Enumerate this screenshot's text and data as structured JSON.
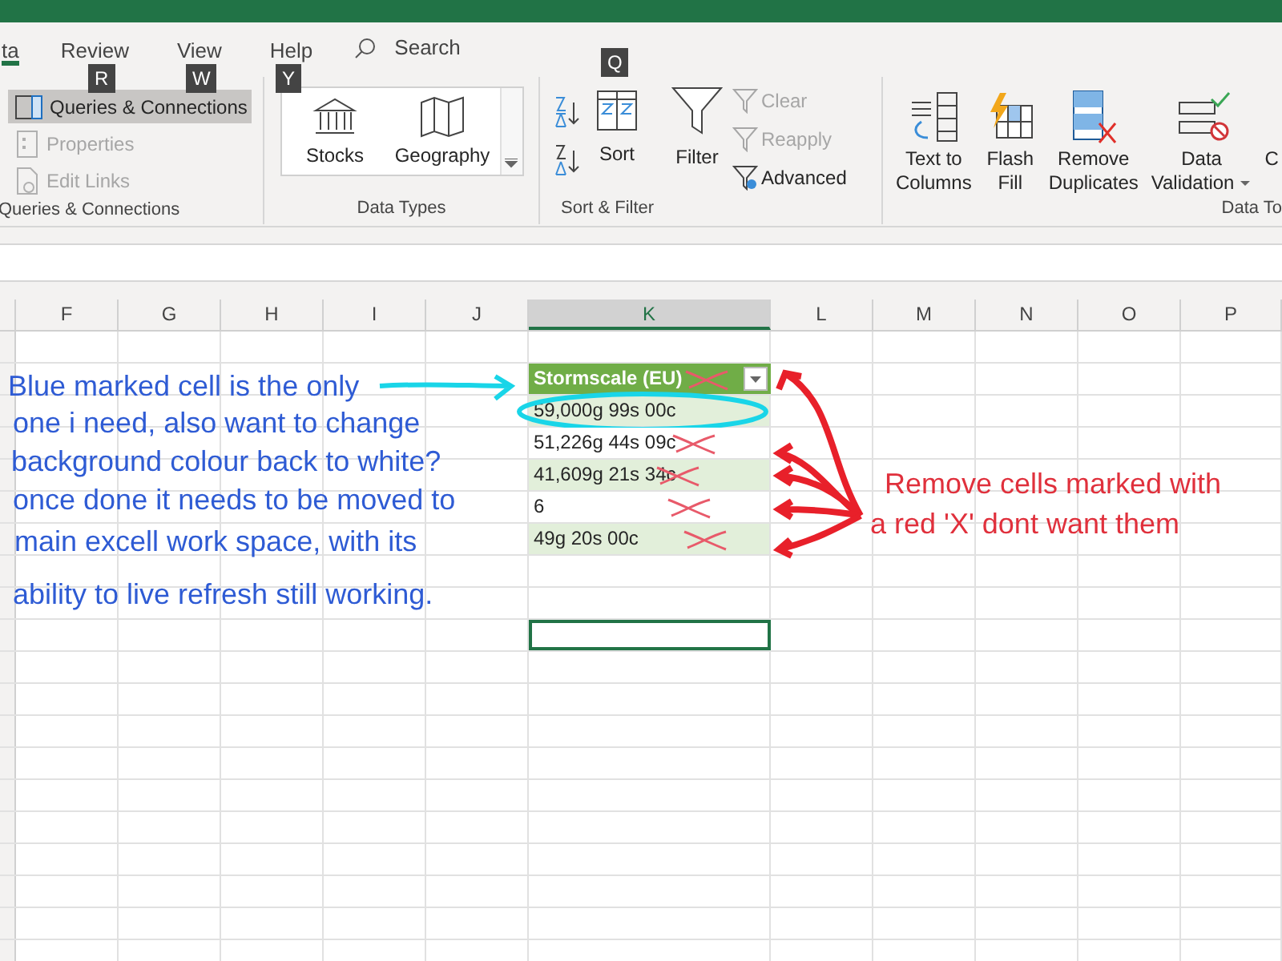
{
  "ribbon_tabs": [
    {
      "label": "ta",
      "selected": true
    },
    {
      "label": "Review",
      "keytip": "R",
      "selected": false
    },
    {
      "label": "View",
      "keytip": "W",
      "selected": false
    },
    {
      "label": "Help",
      "keytip": "Y",
      "selected": false
    }
  ],
  "search": {
    "label": "Search",
    "keytip": "Q"
  },
  "queries_connections": {
    "label": "Queries & Connections",
    "items": [
      {
        "label": "Queries & Connections",
        "disabled": false,
        "highlighted": true
      },
      {
        "label": "Properties",
        "disabled": true,
        "highlighted": false
      },
      {
        "label": "Edit Links",
        "disabled": true,
        "highlighted": false
      }
    ]
  },
  "data_types": {
    "label": "Data Types",
    "items": [
      "Stocks",
      "Geography"
    ]
  },
  "sort_filter": {
    "label": "Sort & Filter",
    "sort": "Sort",
    "filter": "Filter",
    "options": [
      {
        "label": "Clear",
        "disabled": true
      },
      {
        "label": "Reapply",
        "disabled": true
      },
      {
        "label": "Advanced",
        "disabled": false
      }
    ]
  },
  "data_tools": {
    "label": "Data To",
    "buttons": [
      {
        "lines": [
          "Text to",
          "Columns"
        ],
        "dropdown": false
      },
      {
        "lines": [
          "Flash",
          "Fill"
        ],
        "dropdown": false
      },
      {
        "lines": [
          "Remove",
          "Duplicates"
        ],
        "dropdown": false
      },
      {
        "lines": [
          "Data",
          "Validation"
        ],
        "dropdown": true
      },
      {
        "lines": [
          "C"
        ],
        "dropdown": false
      }
    ]
  },
  "columns": [
    {
      "label": "F",
      "selected": false
    },
    {
      "label": "G",
      "selected": false
    },
    {
      "label": "H",
      "selected": false
    },
    {
      "label": "I",
      "selected": false
    },
    {
      "label": "J",
      "selected": false
    },
    {
      "label": "K",
      "selected": true
    },
    {
      "label": "L",
      "selected": false
    },
    {
      "label": "M",
      "selected": false
    },
    {
      "label": "N",
      "selected": false
    },
    {
      "label": "O",
      "selected": false
    },
    {
      "label": "P",
      "selected": false
    }
  ],
  "table": {
    "header": {
      "text": "Stormscale (EU)",
      "crossed": true
    },
    "rows": [
      {
        "text": "59,000g 99s 00c",
        "crossed": false,
        "circled": true
      },
      {
        "text": "51,226g 44s 09c",
        "crossed": true,
        "circled": false
      },
      {
        "text": "41,609g 21s 34c",
        "crossed": true,
        "circled": false
      },
      {
        "text": "6",
        "crossed": true,
        "circled": false
      },
      {
        "text": "49g 20s 00c",
        "crossed": true,
        "circled": false
      }
    ]
  },
  "blue_note": [
    "Blue marked cell is the only",
    "one i need, also want to change",
    "background colour back to white?",
    "once done it needs to be moved to",
    "main excell work space, with its",
    "ability to live refresh still working."
  ],
  "red_note": [
    "Remove cells marked with",
    "a red 'X' dont want them"
  ]
}
